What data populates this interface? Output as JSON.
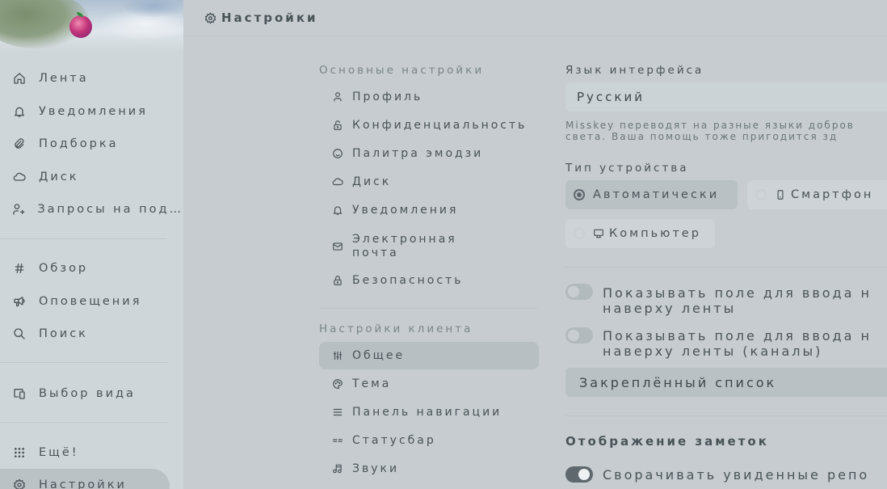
{
  "header": {
    "title": "Настройки",
    "icon": "gear-icon"
  },
  "sidebar": {
    "items": [
      {
        "label": "Лента",
        "icon": "home-icon"
      },
      {
        "label": "Уведомления",
        "icon": "bell-icon"
      },
      {
        "label": "Подборка",
        "icon": "paperclip-icon"
      },
      {
        "label": "Диск",
        "icon": "cloud-icon"
      },
      {
        "label": "Запросы на под…",
        "icon": "user-plus-icon"
      },
      {
        "label": "Обзор",
        "icon": "hash-icon"
      },
      {
        "label": "Оповещения",
        "icon": "megaphone-icon"
      },
      {
        "label": "Поиск",
        "icon": "search-icon"
      },
      {
        "label": "Выбор вида",
        "icon": "devices-icon"
      },
      {
        "label": "Ещё!",
        "icon": "grid-dots-icon"
      },
      {
        "label": "Настройки",
        "icon": "gear-icon"
      }
    ]
  },
  "menu": {
    "basic_title": "Основные настройки",
    "basic_items": [
      {
        "label": "Профиль",
        "icon": "user-icon"
      },
      {
        "label": "Конфиденциальность",
        "icon": "lock-open-icon"
      },
      {
        "label": "Палитра эмодзи",
        "icon": "mood-smile-icon"
      },
      {
        "label": "Диск",
        "icon": "cloud-icon"
      },
      {
        "label": "Уведомления",
        "icon": "bell-icon"
      },
      {
        "label_line1": "Электронная",
        "label_line2": "почта",
        "icon": "mail-icon"
      },
      {
        "label": "Безопасность",
        "icon": "lock-icon"
      }
    ],
    "client_title": "Настройки клиента",
    "client_items": [
      {
        "label": "Общее",
        "icon": "adjustments-icon"
      },
      {
        "label": "Тема",
        "icon": "palette-icon"
      },
      {
        "label": "Панель навигации",
        "icon": "menu-icon"
      },
      {
        "label": "Статусбар",
        "icon": "status-bar-icon"
      },
      {
        "label": "Звуки",
        "icon": "music-icon"
      }
    ]
  },
  "content": {
    "language_label": "Язык интерфейса",
    "language_value": "Русский",
    "language_caption_line1": "Misskey переводят на разные языки добров",
    "language_caption_line2": "света. Ваша помощь тоже пригодится зд",
    "device_label": "Тип устройства",
    "device_options": [
      {
        "label": "Автоматически",
        "selected": true
      },
      {
        "label": "Смартфон",
        "selected": false,
        "icon": "smartphone-icon"
      },
      {
        "label": "Компьютер",
        "selected": false,
        "icon": "desktop-icon"
      }
    ],
    "toggle1": {
      "line1": "Показывать поле для ввода н",
      "line2": "наверху ленты",
      "on": false
    },
    "toggle2": {
      "line1": "Показывать поле для ввода н",
      "line2": "наверху ленты (каналы)",
      "on": false
    },
    "pinned_button": "Закреплённый список",
    "notes_heading": "Отображение заметок",
    "toggle3": {
      "line1": "Сворачивать увиденные репо",
      "on": true
    }
  }
}
